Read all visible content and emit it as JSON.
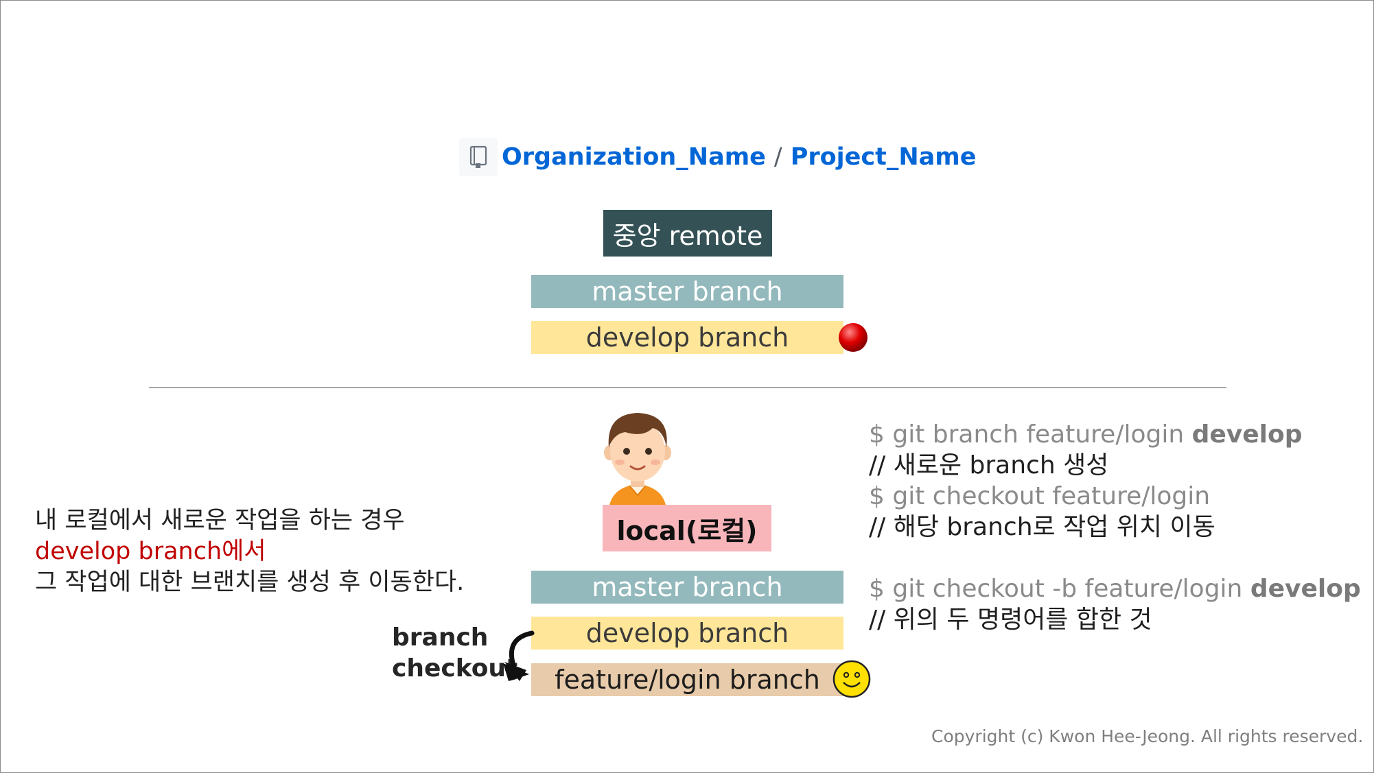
{
  "repo": {
    "organization": "Organization_Name",
    "separator": "/",
    "project": "Project_Name",
    "icon": "repo-book-icon"
  },
  "remote": {
    "label": "중앙 remote",
    "master": "master branch",
    "develop": "develop branch",
    "marker_icon": "red-dot-icon"
  },
  "local": {
    "avatar_icon": "developer-avatar-icon",
    "label": "local(로컬)",
    "master": "master branch",
    "develop": "develop branch",
    "feature": "feature/login branch",
    "marker_icon": "smiley-icon",
    "checkout_line1": "branch",
    "checkout_line2": "checkout",
    "arrow_icon": "curved-arrow-icon"
  },
  "description": {
    "line1": "내 로컬에서 새로운 작업을 하는 경우",
    "line2": "develop branch에서",
    "line3": "그 작업에 대한 브랜치를 생성 후 이동한다."
  },
  "commands": {
    "c1_prefix": "$ git branch feature/login ",
    "c1_bold": "develop",
    "c1_comment": "// 새로운 branch 생성",
    "c2": "$ git checkout feature/login",
    "c2_comment": "// 해당 branch로 작업 위치 이동",
    "c3_prefix": "$ git checkout -b feature/login ",
    "c3_bold": "develop",
    "c3_comment": "// 위의 두 명령어를 합한 것"
  },
  "copyright": "Copyright (c) Kwon Hee-Jeong. All rights reserved.",
  "colors": {
    "link_blue": "#0366d6",
    "remote_box": "#345256",
    "master_bar": "#93b9bc",
    "develop_bar": "#ffe699",
    "feature_bar": "#e8cbaa",
    "local_box": "#f8b6bb",
    "highlight_red": "#c00000"
  }
}
